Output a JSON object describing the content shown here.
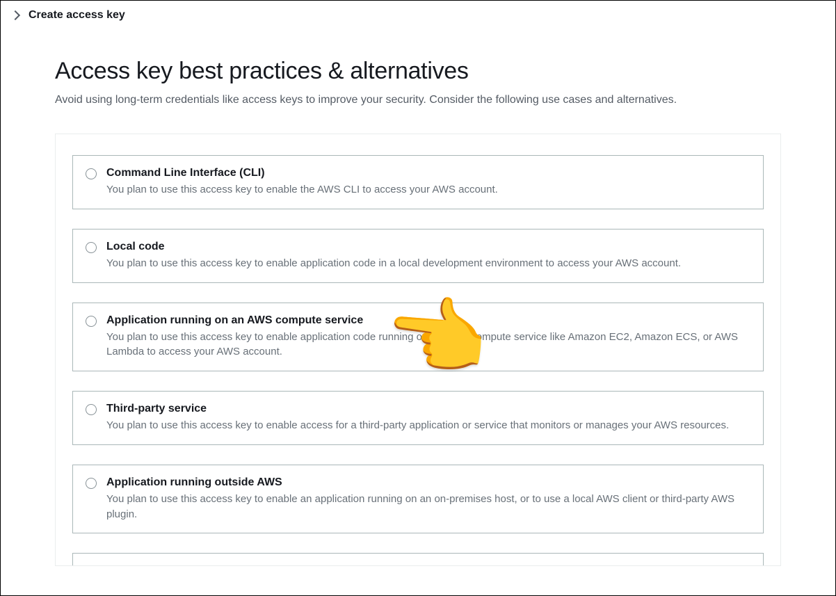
{
  "breadcrumb": {
    "label": "Create access key"
  },
  "header": {
    "title": "Access key best practices & alternatives",
    "subtitle": "Avoid using long-term credentials like access keys to improve your security. Consider the following use cases and alternatives."
  },
  "options": [
    {
      "title": "Command Line Interface (CLI)",
      "desc": "You plan to use this access key to enable the AWS CLI to access your AWS account."
    },
    {
      "title": "Local code",
      "desc": "You plan to use this access key to enable application code in a local development environment to access your AWS account."
    },
    {
      "title": "Application running on an AWS compute service",
      "desc": "You plan to use this access key to enable application code running on an AWS compute service like Amazon EC2, Amazon ECS, or AWS Lambda to access your AWS account."
    },
    {
      "title": "Third-party service",
      "desc": "You plan to use this access key to enable access for a third-party application or service that monitors or manages your AWS resources."
    },
    {
      "title": "Application running outside AWS",
      "desc": "You plan to use this access key to enable an application running on an on-premises host, or to use a local AWS client or third-party AWS plugin."
    }
  ],
  "pointer": {
    "glyph": "👉"
  }
}
